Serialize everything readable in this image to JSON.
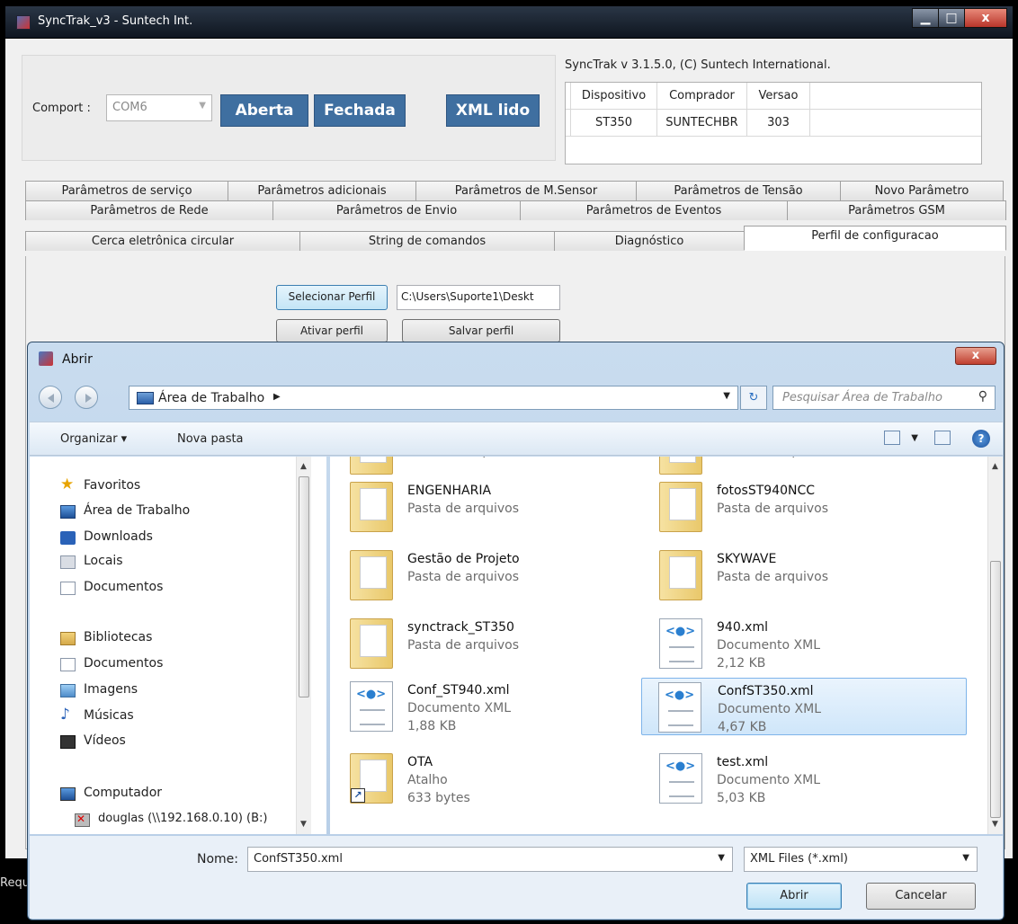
{
  "app": {
    "title": "SyncTrak_v3 - Suntech Int.",
    "min": "▁",
    "max": "□",
    "close": "x",
    "version_text": "SyncTrak v 3.1.5.0, (C) Suntech International.",
    "comport_label": "Comport :",
    "comport_value": "COM6",
    "btn_aberta": "Aberta",
    "btn_fechada": "Fechada",
    "btn_xml": "XML lido",
    "table": {
      "headers": [
        "Dispositivo",
        "Comprador",
        "Versao"
      ],
      "row": [
        "ST350",
        "SUNTECHBR",
        "303"
      ]
    },
    "tabs_row1": [
      "Parâmetros de serviço",
      "Parâmetros adicionais",
      "Parâmetros  de M.Sensor",
      "Parâmetros de Tensão",
      "Novo Parâmetro"
    ],
    "tabs_row2": [
      "Parâmetros de Rede",
      "Parâmetros de Envio",
      "Parâmetros de Eventos",
      "Parâmetros GSM"
    ],
    "tabs_row3": [
      "Cerca eletrônica circular",
      "String de comandos",
      "Diagnóstico",
      "Perfil de configuracao"
    ],
    "panel": {
      "select_profile": "Selecionar Perfil",
      "path": "C:\\Users\\Suporte1\\Deskt",
      "activate": "Ativar perfil",
      "save": "Salvar perfil"
    },
    "status_text": "Requ"
  },
  "dialog": {
    "title": "Abrir",
    "close": "x",
    "address": "Área de Trabalho",
    "search_placeholder": "Pesquisar Área de Trabalho",
    "organize": "Organizar ▾",
    "new_folder": "Nova pasta",
    "nav": {
      "favorites": "Favoritos",
      "desktop": "Área de Trabalho",
      "downloads": "Downloads",
      "places": "Locais",
      "documents": "Documentos",
      "libraries": "Bibliotecas",
      "lib_documents": "Documentos",
      "images": "Imagens",
      "music": "Músicas",
      "videos": "Vídeos",
      "computer": "Computador",
      "network_drive": "douglas (\\\\192.168.0.10) (B:)"
    },
    "files": [
      {
        "name": "",
        "type": "Pasta de arquivos",
        "size": ""
      },
      {
        "name": "",
        "type": "Pasta de arquivos",
        "size": ""
      },
      {
        "name": "ENGENHARIA",
        "type": "Pasta de arquivos",
        "size": ""
      },
      {
        "name": "fotosST940NCC",
        "type": "Pasta de arquivos",
        "size": ""
      },
      {
        "name": "Gestão de Projeto",
        "type": "Pasta de arquivos",
        "size": ""
      },
      {
        "name": "SKYWAVE",
        "type": "Pasta de arquivos",
        "size": ""
      },
      {
        "name": "synctrack_ST350",
        "type": "Pasta de arquivos",
        "size": ""
      },
      {
        "name": "940.xml",
        "type": "Documento XML",
        "size": "2,12 KB"
      },
      {
        "name": "Conf_ST940.xml",
        "type": "Documento XML",
        "size": "1,88 KB"
      },
      {
        "name": "ConfST350.xml",
        "type": "Documento XML",
        "size": "4,67 KB"
      },
      {
        "name": "OTA",
        "type": "Atalho",
        "size": "633 bytes"
      },
      {
        "name": "test.xml",
        "type": "Documento XML",
        "size": "5,03 KB"
      }
    ],
    "filename_label": "Nome:",
    "filename_value": "ConfST350.xml",
    "filter_value": "XML Files (*.xml)",
    "open": "Abrir",
    "cancel": "Cancelar"
  },
  "colors": {
    "accent_button": "#3f6fa0",
    "selection": "#cfe6fa"
  }
}
